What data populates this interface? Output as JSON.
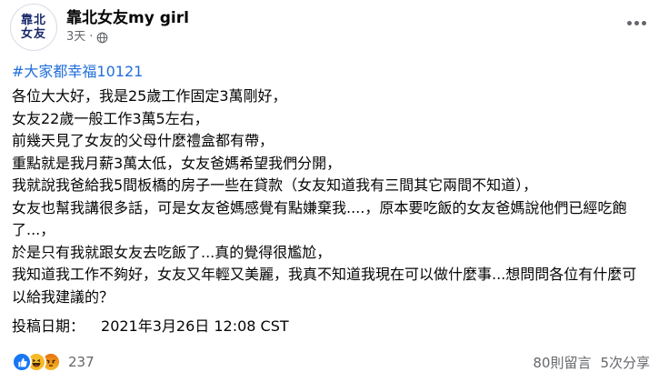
{
  "header": {
    "avatar_line1": "靠北",
    "avatar_line2": "女友",
    "page_name": "靠北女友my girl",
    "time": "3天",
    "globe_icon": "globe-icon",
    "more_icon": "more-options-icon"
  },
  "hashtag": "#大家都幸福10121",
  "body": {
    "lines": [
      "各位大大好，我是25歲工作固定3萬剛好，",
      "女友22歲一般工作3萬5左右，",
      "前幾天見了女友的父母什麼禮盒都有帶，",
      "重點就是我月薪3萬太低，女友爸媽希望我們分開，",
      "我就說我爸給我5間板橋的房子一些在貸款（女友知道我有三間其它兩間不知道），",
      "女友也幫我講很多話，可是女友爸媽感覺有點嫌棄我....，原本要吃飯的女友爸媽說他們已經吃飽了...，",
      "於是只有我就跟女友去吃飯了...真的覺得很尷尬，",
      "我知道我工作不夠好，女友又年輕又美麗，我真不知道我現在可以做什麼事...想問問各位有什麼可以給我建議的？"
    ]
  },
  "posted": {
    "label": "投稿日期：",
    "value": "2021年3月26日 12:08 CST"
  },
  "footer": {
    "reaction_icons": [
      "like-icon",
      "haha-icon",
      "angry-icon"
    ],
    "reaction_count": "237",
    "comments": "80則留言",
    "shares": "5次分享"
  },
  "colors": {
    "hashtag": "#216fdb",
    "meta_text": "#65676b",
    "like": "#1877f2",
    "haha": "#f7b928"
  }
}
